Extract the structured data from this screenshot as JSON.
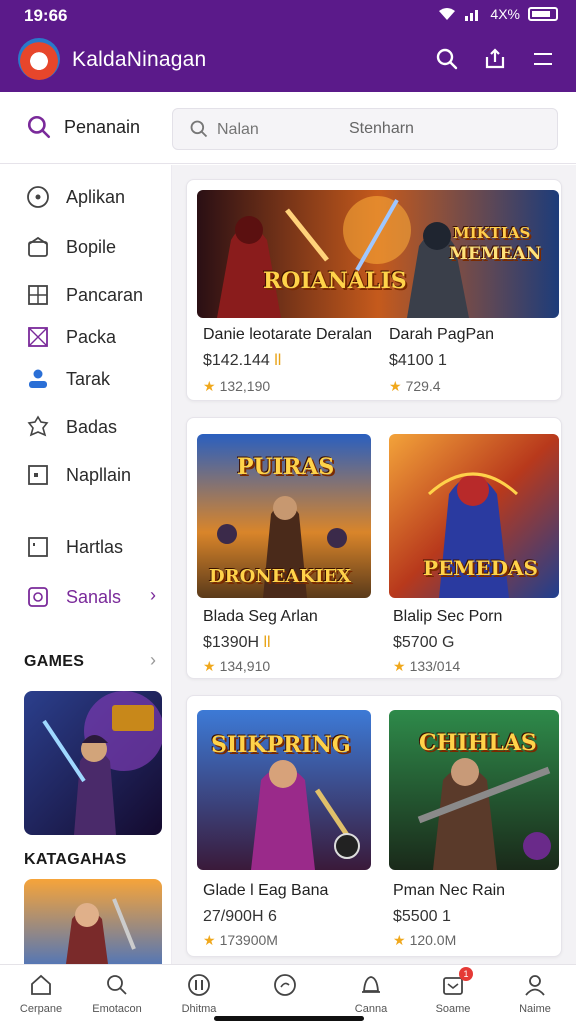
{
  "status": {
    "time": "19:66",
    "signal_text": "4X%"
  },
  "app": {
    "title": "KaldaNinagan"
  },
  "search": {
    "section_label": "Penanain",
    "placeholder": "Nalan",
    "hint": "Stenharn"
  },
  "sidebar": {
    "items": [
      {
        "label": "Aplikan",
        "icon": "compass-icon"
      },
      {
        "label": "Bopile",
        "icon": "box-icon"
      },
      {
        "label": "Pancaran",
        "icon": "grid-icon"
      },
      {
        "label": "Packa",
        "icon": "package-icon"
      },
      {
        "label": "Tarak",
        "icon": "user-icon"
      },
      {
        "label": "Badas",
        "icon": "badge-icon"
      },
      {
        "label": "Napllain",
        "icon": "window-icon"
      },
      {
        "label": "Hartlas",
        "icon": "square-icon"
      },
      {
        "label": "Sanals",
        "icon": "circle-square-icon",
        "active": true
      }
    ],
    "section_games": "GAMES",
    "section_categories": "KATAGAHAS"
  },
  "cards": [
    {
      "title": "Danie leotarate Deralan",
      "price": "$142.144",
      "rating": "132,190",
      "art_text": [
        "ROIANALIS"
      ]
    },
    {
      "title": "Darah PagPan",
      "price": "$4100",
      "price_suffix": "1",
      "rating": "729.4",
      "art_text": [
        "MIKTIAS",
        "MEMEAN"
      ]
    },
    {
      "title": "Blada Seg Arlan",
      "price": "$1390H",
      "rating": "134,910",
      "art_text": [
        "PUIRAS",
        "DRONEAKIEX"
      ]
    },
    {
      "title": "Blalip Sec Porn",
      "price": "$5700",
      "price_suffix": "G",
      "rating": "133/014",
      "art_text": [
        "PEMEDAS"
      ]
    },
    {
      "title": "Glade l Eag Bana",
      "price": "27/900H",
      "price_suffix": "6",
      "rating": "173900M",
      "art_text": [
        "SIIKPRING"
      ]
    },
    {
      "title": "Pman Nec Rain",
      "price": "$5500",
      "price_suffix": "1",
      "rating": "120.0M",
      "art_text": [
        "CHIHLAS"
      ]
    }
  ],
  "bottom_nav": [
    {
      "label": "Cerpane",
      "icon": "home-icon"
    },
    {
      "label": "Emotacon",
      "icon": "search-icon"
    },
    {
      "label": "Dhitma",
      "icon": "pause-icon"
    },
    {
      "label": "",
      "icon": "chat-icon"
    },
    {
      "label": "Canna",
      "icon": "bell-icon"
    },
    {
      "label": "Soame",
      "icon": "inbox-icon",
      "badge": "1"
    },
    {
      "label": "Naime",
      "icon": "person-icon"
    }
  ],
  "colors": {
    "brand": "#5b1a8a",
    "accent": "#7a2a9a",
    "star": "#f0a81c"
  }
}
